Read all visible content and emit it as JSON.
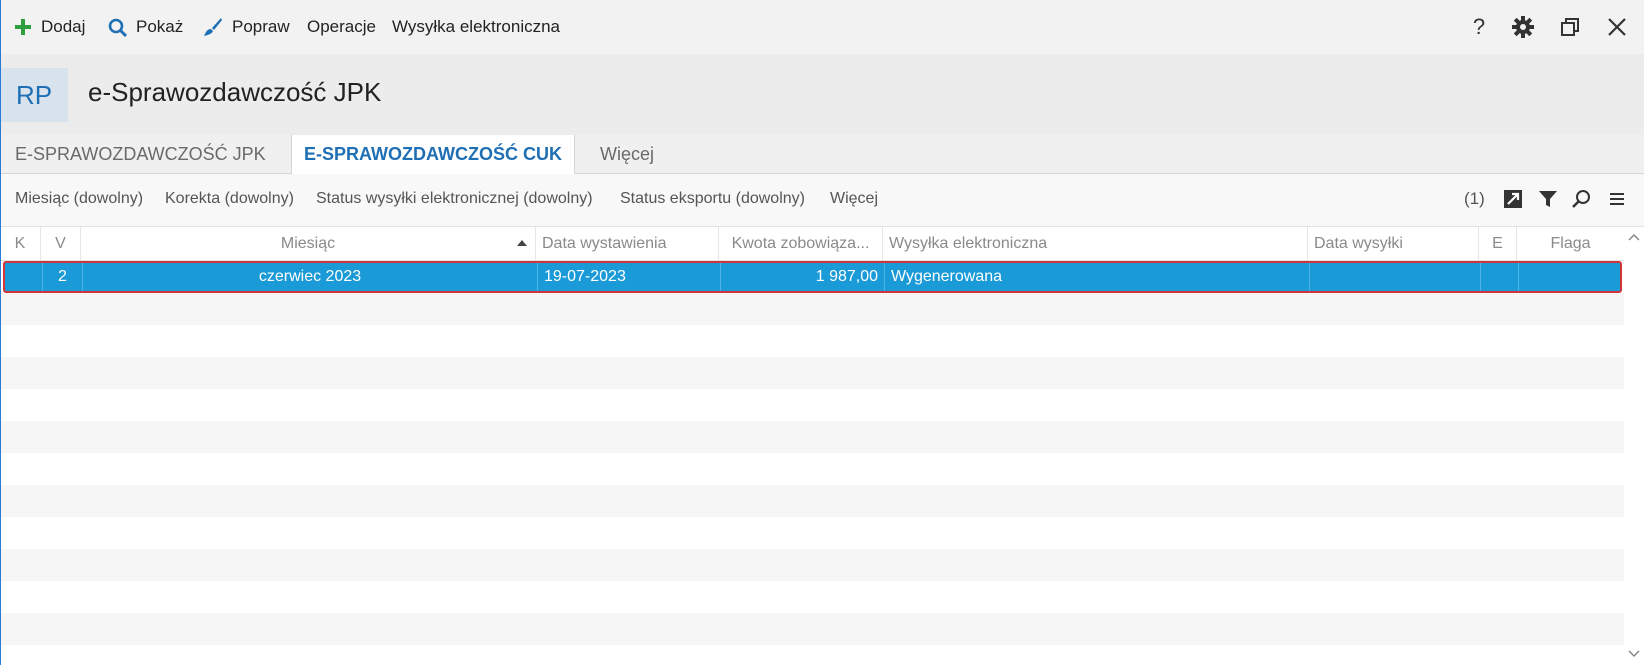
{
  "toolbar": {
    "add_label": "Dodaj",
    "show_label": "Pokaż",
    "edit_label": "Popraw",
    "operations_label": "Operacje",
    "esend_label": "Wysyłka elektroniczna",
    "help_glyph": "?"
  },
  "header": {
    "badge": "RP",
    "title": "e-Sprawozdawczość JPK"
  },
  "tabs": [
    {
      "label": "E-SPRAWOZDAWCZOŚĆ JPK"
    },
    {
      "label": "E-SPRAWOZDAWCZOŚĆ CUK"
    },
    {
      "label": "Więcej"
    }
  ],
  "filters": {
    "items": [
      {
        "label": "Miesiąc (dowolny)"
      },
      {
        "label": "Korekta (dowolny)"
      },
      {
        "label": "Status wysyłki elektronicznej (dowolny)"
      },
      {
        "label": "Status eksportu (dowolny)"
      },
      {
        "label": "Więcej"
      }
    ],
    "count": "(1)"
  },
  "grid": {
    "columns": [
      {
        "label": "K"
      },
      {
        "label": "V"
      },
      {
        "label": "Miesiąc"
      },
      {
        "label": "Data wystawienia"
      },
      {
        "label": "Kwota zobowiąza..."
      },
      {
        "label": "Wysyłka elektroniczna"
      },
      {
        "label": "Data wysyłki"
      },
      {
        "label": "E"
      },
      {
        "label": "Flaga"
      }
    ],
    "rows": [
      {
        "k": "",
        "v": "2",
        "miesiac": "czerwiec 2023",
        "data_wystawienia": "19-07-2023",
        "kwota": "1 987,00",
        "wysylka": "Wygenerowana",
        "data_wysylki": "",
        "e": "",
        "flaga": ""
      }
    ]
  },
  "colors": {
    "accent": "#1f6fb5",
    "selected_row": "#1a9ad7",
    "selection_border": "#d0353b",
    "add_icon": "#2e9e3e"
  }
}
